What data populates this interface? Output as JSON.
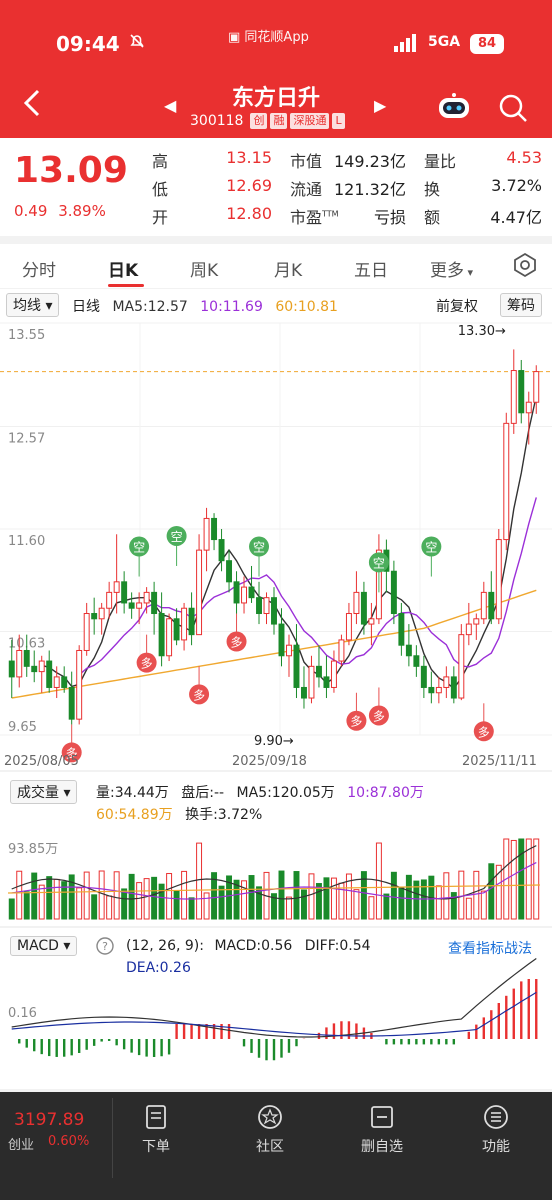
{
  "status_bar": {
    "time": "09:44",
    "app_name": "同花顺App",
    "network": "5GA",
    "battery": "84"
  },
  "header": {
    "stock_name": "东方日升",
    "stock_code": "300118",
    "tags": [
      "创",
      "融",
      "深股通",
      "L"
    ]
  },
  "quote": {
    "price": "13.09",
    "change": "0.49",
    "change_pct": "3.89%",
    "fields": [
      {
        "label": "高",
        "value": "13.15",
        "color": "red"
      },
      {
        "label": "市值",
        "value": "149.23亿",
        "color": "black"
      },
      {
        "label": "量比",
        "value": "4.53",
        "color": "red"
      },
      {
        "label": "低",
        "value": "12.69",
        "color": "red"
      },
      {
        "label": "流通",
        "value": "121.32亿",
        "color": "black"
      },
      {
        "label": "换",
        "value": "3.72%",
        "color": "black"
      },
      {
        "label": "开",
        "value": "12.80",
        "color": "red"
      },
      {
        "label": "市盈",
        "sup": "TTM",
        "value": "亏损",
        "color": "black"
      },
      {
        "label": "额",
        "value": "4.47亿",
        "color": "black"
      }
    ]
  },
  "tabs": [
    "分时",
    "日K",
    "周K",
    "月K",
    "五日",
    "更多"
  ],
  "active_tab": "日K",
  "kline": {
    "indicator_selector": "均线",
    "period_label": "日线",
    "ma5": "MA5:12.57",
    "ma10": "10:11.69",
    "ma60": "60:10.81",
    "adjust": "前复权",
    "chips_button": "筹码",
    "y_labels": [
      "13.55",
      "12.57",
      "11.60",
      "10.63",
      "9.65"
    ],
    "date_labels": [
      "2025/08/05",
      "2025/09/18",
      "2025/11/11"
    ],
    "high_mark": "13.30",
    "low_mark": "9.90",
    "signal_buy": "多",
    "signal_sell": "空"
  },
  "volume": {
    "selector": "成交量",
    "vol": "量:34.44万",
    "after": "盘后:--",
    "ma5": "MA5:120.05万",
    "ma10": "10:87.80万",
    "ma60": "60:54.89万",
    "turnover": "换手:3.72%",
    "y_label": "93.85万"
  },
  "macd": {
    "selector": "MACD",
    "params": "(12, 26, 9):",
    "macd": "MACD:0.56",
    "diff": "DIFF:0.54",
    "dea": "DEA:0.26",
    "link": "查看指标战法",
    "y_label": "0.16"
  },
  "bottom_nav": {
    "index_value": "3197.89",
    "index_name": "创业",
    "index_pct": "0.60%",
    "items": [
      "下单",
      "社区",
      "删自选",
      "功能"
    ]
  },
  "chart_data": {
    "type": "candlestick",
    "price_range": [
      9.65,
      13.55
    ],
    "x_start": "2025/08/05",
    "x_mid": "2025/09/18",
    "x_end": "2025/11/11",
    "colors": {
      "up": "#e93030",
      "down": "#1a8a2a",
      "ma5": "#333333",
      "ma10": "#9b30d8",
      "ma60": "#f0a830"
    },
    "candles": [
      [
        10.35,
        10.55,
        10.0,
        10.2
      ],
      [
        10.2,
        10.6,
        10.1,
        10.45
      ],
      [
        10.45,
        10.6,
        10.2,
        10.3
      ],
      [
        10.3,
        10.45,
        10.15,
        10.25
      ],
      [
        10.25,
        10.4,
        10.05,
        10.35
      ],
      [
        10.35,
        10.45,
        10.05,
        10.1
      ],
      [
        10.1,
        10.3,
        10.0,
        10.2
      ],
      [
        10.2,
        10.3,
        10.05,
        10.1
      ],
      [
        10.1,
        10.25,
        9.75,
        9.8
      ],
      [
        9.8,
        10.5,
        9.75,
        10.45
      ],
      [
        10.45,
        10.9,
        10.4,
        10.8
      ],
      [
        10.8,
        10.95,
        10.6,
        10.75
      ],
      [
        10.75,
        10.9,
        10.6,
        10.85
      ],
      [
        10.85,
        11.1,
        10.75,
        11.0
      ],
      [
        11.0,
        11.55,
        10.8,
        11.1
      ],
      [
        11.1,
        11.2,
        10.8,
        10.9
      ],
      [
        10.9,
        11.0,
        10.75,
        10.85
      ],
      [
        10.85,
        11.0,
        10.7,
        10.9
      ],
      [
        10.9,
        11.05,
        10.8,
        11.0
      ],
      [
        11.0,
        11.1,
        10.6,
        10.8
      ],
      [
        10.8,
        11.0,
        10.3,
        10.4
      ],
      [
        10.4,
        10.8,
        10.35,
        10.75
      ],
      [
        10.75,
        10.85,
        10.5,
        10.55
      ],
      [
        10.55,
        10.9,
        10.45,
        10.85
      ],
      [
        10.85,
        11.0,
        10.5,
        10.6
      ],
      [
        10.6,
        11.55,
        10.6,
        11.4
      ],
      [
        11.4,
        11.8,
        11.2,
        11.7
      ],
      [
        11.7,
        11.75,
        11.4,
        11.5
      ],
      [
        11.5,
        11.6,
        11.2,
        11.3
      ],
      [
        11.3,
        11.4,
        11.0,
        11.1
      ],
      [
        11.1,
        11.2,
        10.8,
        10.9
      ],
      [
        10.9,
        11.15,
        10.8,
        11.05
      ],
      [
        11.05,
        11.25,
        10.9,
        10.95
      ],
      [
        10.95,
        11.1,
        10.7,
        10.8
      ],
      [
        10.8,
        11.0,
        10.7,
        10.95
      ],
      [
        10.95,
        11.05,
        10.6,
        10.7
      ],
      [
        10.7,
        10.85,
        10.3,
        10.4
      ],
      [
        10.4,
        10.6,
        10.2,
        10.5
      ],
      [
        10.5,
        10.7,
        10.0,
        10.1
      ],
      [
        10.1,
        10.3,
        9.9,
        10.0
      ],
      [
        10.0,
        10.4,
        9.95,
        10.3
      ],
      [
        10.3,
        10.5,
        10.1,
        10.2
      ],
      [
        10.2,
        10.4,
        10.0,
        10.1
      ],
      [
        10.1,
        10.45,
        10.05,
        10.35
      ],
      [
        10.35,
        10.6,
        10.3,
        10.55
      ],
      [
        10.55,
        10.9,
        10.5,
        10.8
      ],
      [
        10.8,
        11.2,
        10.7,
        11.0
      ],
      [
        11.0,
        11.1,
        10.6,
        10.7
      ],
      [
        10.7,
        10.9,
        10.5,
        10.75
      ],
      [
        10.75,
        11.55,
        10.7,
        11.4
      ],
      [
        11.4,
        11.5,
        11.0,
        11.2
      ],
      [
        11.2,
        11.3,
        10.7,
        10.8
      ],
      [
        10.8,
        10.9,
        10.4,
        10.5
      ],
      [
        10.5,
        10.7,
        10.3,
        10.4
      ],
      [
        10.4,
        10.5,
        10.2,
        10.3
      ],
      [
        10.3,
        10.4,
        10.0,
        10.1
      ],
      [
        10.1,
        10.25,
        9.95,
        10.05
      ],
      [
        10.05,
        10.2,
        9.95,
        10.1
      ],
      [
        10.1,
        10.3,
        10.0,
        10.2
      ],
      [
        10.2,
        10.3,
        9.95,
        10.0
      ],
      [
        10.0,
        10.7,
        9.98,
        10.6
      ],
      [
        10.6,
        10.9,
        10.5,
        10.7
      ],
      [
        10.7,
        10.8,
        10.55,
        10.75
      ],
      [
        10.75,
        11.1,
        10.7,
        11.0
      ],
      [
        11.0,
        11.2,
        10.7,
        10.75
      ],
      [
        10.75,
        11.6,
        10.7,
        11.5
      ],
      [
        11.5,
        12.7,
        11.4,
        12.6
      ],
      [
        12.6,
        13.3,
        12.5,
        13.1
      ],
      [
        13.1,
        13.2,
        12.6,
        12.7
      ],
      [
        12.7,
        12.9,
        12.4,
        12.8
      ],
      [
        12.8,
        13.15,
        12.69,
        13.09
      ]
    ]
  }
}
